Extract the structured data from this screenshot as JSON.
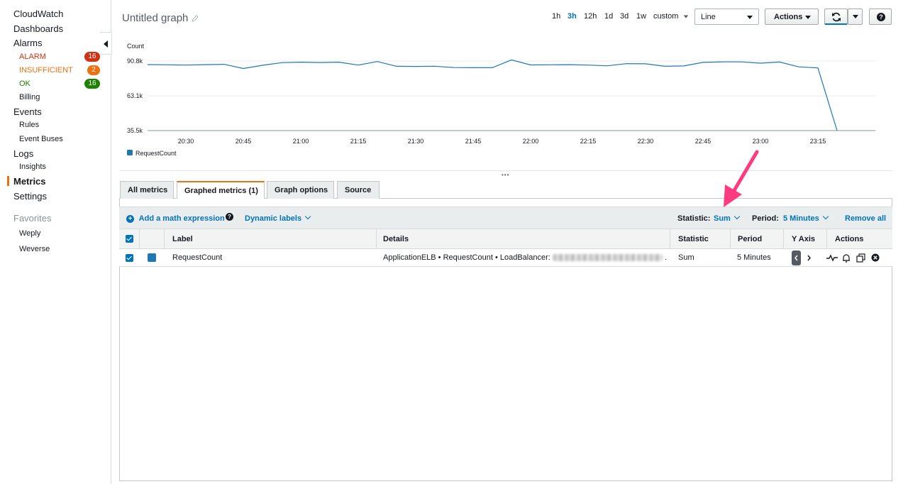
{
  "sidebar": {
    "items": [
      {
        "label": "CloudWatch"
      },
      {
        "label": "Dashboards"
      },
      {
        "label": "Alarms"
      },
      {
        "label": "ALARM",
        "count": "16"
      },
      {
        "label": "INSUFFICIENT",
        "count": "2"
      },
      {
        "label": "OK",
        "count": "16"
      },
      {
        "label": "Billing"
      },
      {
        "label": "Events"
      },
      {
        "label": "Rules"
      },
      {
        "label": "Event Buses"
      },
      {
        "label": "Logs"
      },
      {
        "label": "Insights"
      },
      {
        "label": "Metrics"
      },
      {
        "label": "Settings"
      }
    ],
    "favorites_label": "Favorites",
    "favorites": [
      {
        "label": "Weply"
      },
      {
        "label": "Weverse"
      }
    ],
    "colors": {
      "alarm": "#d13212",
      "insufficient": "#ec7211",
      "ok": "#1d8102",
      "active": "#ec7211"
    }
  },
  "header": {
    "title": "Untitled graph",
    "ranges": [
      "1h",
      "3h",
      "12h",
      "1d",
      "3d",
      "1w"
    ],
    "active_range": "3h",
    "custom_label": "custom",
    "chart_type": "Line",
    "actions_label": "Actions",
    "help_label": "?"
  },
  "chart_data": {
    "type": "line",
    "ylabel": "Count",
    "yticks": [
      "90.8k",
      "63.1k",
      "35.5k"
    ],
    "ytick_values": [
      90800,
      63100,
      35500
    ],
    "ylim": [
      35500,
      90800
    ],
    "xticks": [
      "20:30",
      "20:45",
      "21:00",
      "21:15",
      "21:30",
      "21:45",
      "22:00",
      "22:15",
      "22:30",
      "22:45",
      "23:00",
      "23:15"
    ],
    "series": [
      {
        "name": "RequestCount",
        "color": "#1f77b4",
        "x_minutes": [
          0,
          5,
          10,
          15,
          20,
          25,
          30,
          35,
          40,
          45,
          50,
          55,
          60,
          65,
          70,
          75,
          80,
          85,
          90,
          95,
          100,
          105,
          110,
          115,
          120,
          125,
          130,
          135,
          140,
          145,
          150,
          155,
          160,
          165,
          170,
          175,
          180,
          185,
          190
        ],
        "values": [
          88000,
          87800,
          87600,
          87900,
          88200,
          84900,
          87400,
          89500,
          89900,
          89600,
          89900,
          87600,
          90400,
          86600,
          86500,
          86700,
          85600,
          85500,
          85500,
          91700,
          87700,
          87800,
          87900,
          87600,
          87000,
          88700,
          88600,
          86600,
          86900,
          89700,
          90100,
          90100,
          89100,
          90000,
          86200,
          85300,
          35500
        ]
      }
    ],
    "legend": "bottom-left",
    "grid": true
  },
  "tabs": [
    {
      "label": "All metrics"
    },
    {
      "label": "Graphed metrics (1)"
    },
    {
      "label": "Graph options"
    },
    {
      "label": "Source"
    }
  ],
  "toolbar": {
    "add_math": "Add a math expression",
    "dynamic_labels": "Dynamic labels",
    "statistic_label": "Statistic:",
    "statistic_value": "Sum",
    "period_label": "Period:",
    "period_value": "5 Minutes",
    "remove_all": "Remove all"
  },
  "table": {
    "headers": [
      "Label",
      "Details",
      "Statistic",
      "Period",
      "Y Axis",
      "Actions"
    ],
    "rows": [
      {
        "label": "RequestCount",
        "details": "ApplicationELB • RequestCount • LoadBalancer:",
        "details_tail": ".",
        "statistic": "Sum",
        "period": "5 Minutes",
        "color": "#1f77b4"
      }
    ]
  }
}
